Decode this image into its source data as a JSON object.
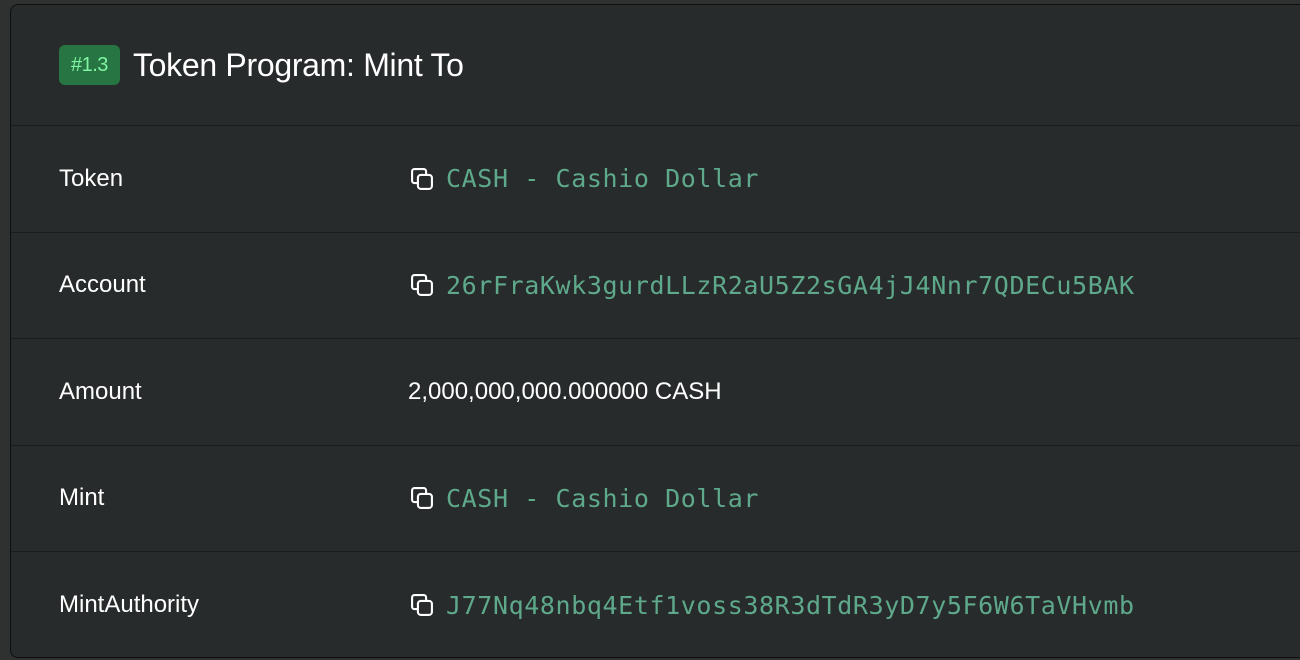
{
  "header": {
    "badge": "#1.3",
    "title": "Token Program: Mint To"
  },
  "rows": [
    {
      "label": "Token",
      "value": "CASH - Cashio Dollar",
      "copyable": true
    },
    {
      "label": "Account",
      "value": "26rFraKwk3gurdLLzR2aU5Z2sGA4jJ4Nnr7QDECu5BAK",
      "copyable": true
    },
    {
      "label": "Amount",
      "value": "2,000,000,000.000000 CASH",
      "copyable": false
    },
    {
      "label": "Mint",
      "value": "CASH - Cashio Dollar",
      "copyable": true
    },
    {
      "label": "MintAuthority",
      "value": "J77Nq48nbq4Etf1voss38R3dTdR3yD7y5F6W6TaVHvmb",
      "copyable": true
    }
  ],
  "icons": {
    "copy": "copy-icon"
  },
  "colors": {
    "badge_bg": "#267543",
    "badge_text": "#7ff5a2",
    "link": "#5ea98b",
    "card_bg": "#282b2b"
  }
}
